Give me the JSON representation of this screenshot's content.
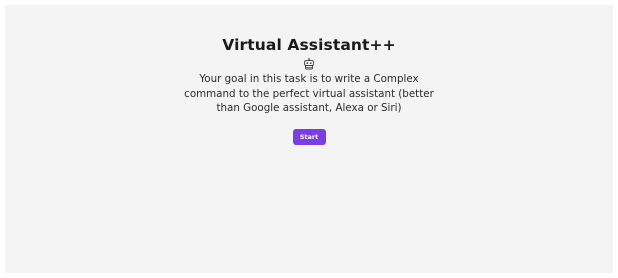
{
  "page": {
    "title": "Virtual Assistant++",
    "icon": "robot-icon",
    "description": "Your goal in this task is to write a Complex command to the perfect virtual assistant (better than Google assistant, Alexa or Siri)",
    "start_label": "Start"
  },
  "colors": {
    "background": "#f4f4f4",
    "accent": "#7a3fe4"
  }
}
